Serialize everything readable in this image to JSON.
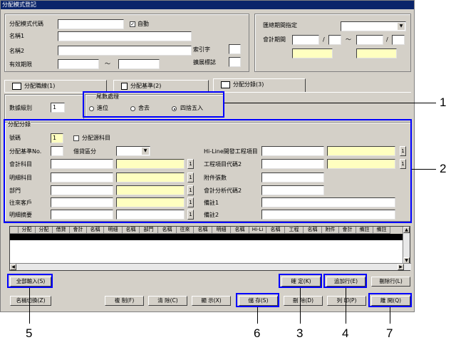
{
  "window": {
    "title": "分配模式登記"
  },
  "header": {
    "code_label": "分配模式代碼",
    "auto_label": "自動",
    "name1_label": "名稱1",
    "name2_label": "名稱2",
    "valid_label": "有效期限",
    "tilde": "〜",
    "index_label": "索引字",
    "extend_label": "擴展標誌"
  },
  "period": {
    "title": "匯總期間指定",
    "accounting_label": "會計期間",
    "slash": "/",
    "tilde": "〜"
  },
  "tabs": [
    {
      "label": "分配職線(1)"
    },
    {
      "label": "分配基準(2)"
    },
    {
      "label": "分配分錄(3)"
    }
  ],
  "digits": {
    "label": "數據級別",
    "value": "1"
  },
  "rounding": {
    "title": "尾數處理",
    "options": [
      "進位",
      "舍去",
      "四捨五入"
    ],
    "selected": 2
  },
  "entry": {
    "title": "分配分錄",
    "no_label": "號碼",
    "no_value": "1",
    "source_chk_label": "分配源科目",
    "base_no_label": "分配基準No.",
    "dc_label": "借貸區分",
    "hiline_label": "Hi-Line開發工程項目",
    "account_label": "會計科目",
    "project2_label": "工程項目代碼2",
    "detail_account_label": "明細科目",
    "attach_label": "附件張數",
    "dept_label": "部門",
    "analysis2_label": "會計分析代碼2",
    "partner_label": "往來客戶",
    "remark1_label": "備註1",
    "summary_label": "明細摘要",
    "remark2_label": "備註2",
    "lookup": "1"
  },
  "grid": {
    "columns": [
      "分配",
      "分配",
      "借貸",
      "會計",
      "名稱",
      "明細",
      "名稱",
      "部門",
      "名稱",
      "往來",
      "名稱",
      "明細",
      "名稱",
      "Hi-Li",
      "名稱",
      "工程",
      "名稱",
      "附件",
      "會計",
      "備註",
      "備註"
    ]
  },
  "buttons": {
    "all_input": "全部輸入(S)",
    "confirm": "確 定(K)",
    "add_row": "追加行(E)",
    "delete_row": "刪除行(L)",
    "name_switch": "名稱切換(Z)",
    "copy": "複 制(F)",
    "clear": "清 除(C)",
    "display": "顯 示(X)",
    "save": "儲 存(S)",
    "delete": "刪 除(D)",
    "print": "列 印(P)",
    "exit": "離 開(Q)"
  },
  "callouts": [
    "1",
    "2",
    "3",
    "4",
    "5",
    "6",
    "7"
  ]
}
